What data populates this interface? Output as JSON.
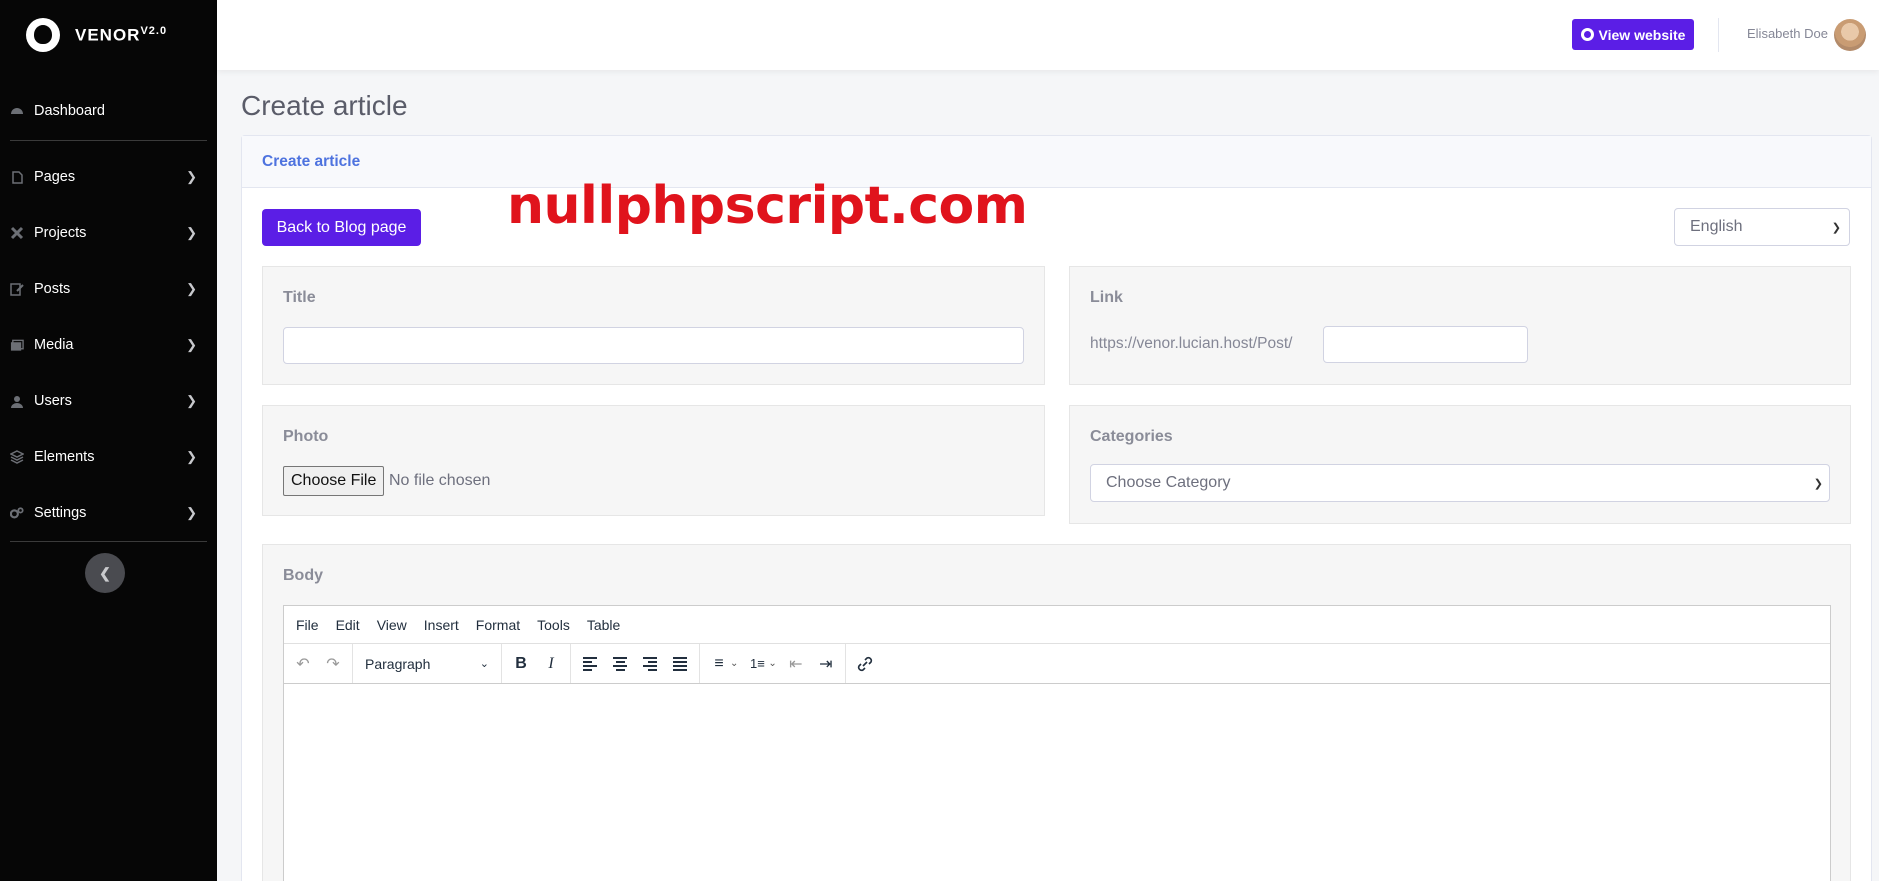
{
  "brand": {
    "name": "VENOR",
    "version": "V2.0"
  },
  "sidebar": {
    "dashboard": "Dashboard",
    "items": [
      {
        "label": "Pages",
        "icon": "file-icon"
      },
      {
        "label": "Projects",
        "icon": "tools-icon"
      },
      {
        "label": "Posts",
        "icon": "edit-icon"
      },
      {
        "label": "Media",
        "icon": "images-icon"
      },
      {
        "label": "Users",
        "icon": "user-icon"
      },
      {
        "label": "Elements",
        "icon": "layers-icon"
      },
      {
        "label": "Settings",
        "icon": "cogs-icon"
      }
    ]
  },
  "topbar": {
    "view_website": "View website",
    "user_name": "Elisabeth Doe"
  },
  "page": {
    "title": "Create article"
  },
  "card": {
    "header": "Create article",
    "back_button": "Back to Blog page",
    "watermark": "nullphpscript.com",
    "language": "English"
  },
  "form": {
    "title_label": "Title",
    "title_value": "",
    "link_label": "Link",
    "link_prefix": "https://venor.lucian.host/Post/",
    "link_value": "",
    "photo_label": "Photo",
    "choose_file": "Choose File",
    "no_file": "No file chosen",
    "categories_label": "Categories",
    "category_placeholder": "Choose Category",
    "body_label": "Body"
  },
  "editor": {
    "menu": [
      "File",
      "Edit",
      "View",
      "Insert",
      "Format",
      "Tools",
      "Table"
    ],
    "block_format": "Paragraph"
  },
  "colors": {
    "accent": "#5b1ee6",
    "sidebar_bg": "#060606",
    "link_blue": "#4e73df",
    "watermark": "#e0131c"
  }
}
